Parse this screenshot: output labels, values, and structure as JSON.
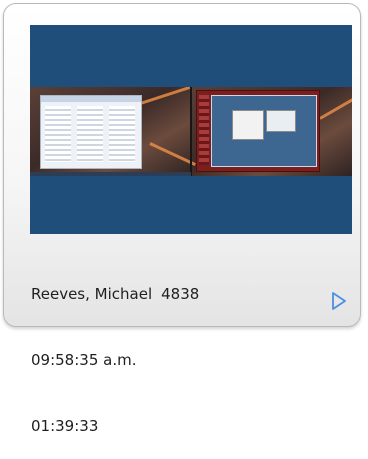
{
  "session": {
    "user_name": "Reeves, Michael",
    "extension": "4838",
    "time": "09:58:35 a.m.",
    "duration": "01:39:33"
  },
  "icons": {
    "play": "play-icon"
  },
  "colors": {
    "preview_background": "#1f4e7b",
    "play_icon": "#4a90e2",
    "text": "#1f1f1f"
  }
}
